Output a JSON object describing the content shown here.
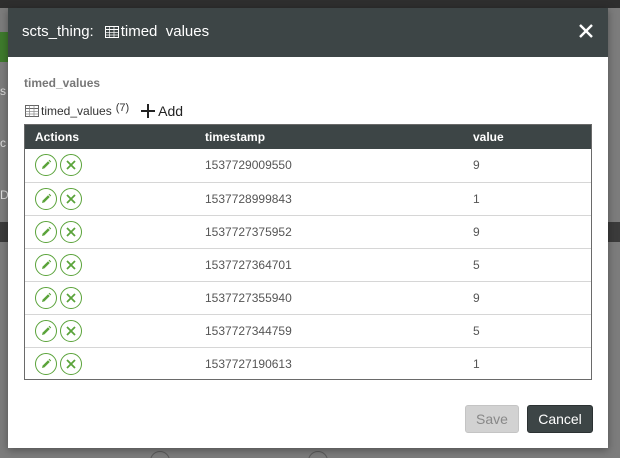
{
  "modal": {
    "thing_name": "scts_thing:",
    "entity_title": "timed  values",
    "section_title": "timed_values",
    "collection_label": "timed_values",
    "collection_count": "(7)",
    "add_label": "Add",
    "columns": [
      "Actions",
      "timestamp",
      "value"
    ],
    "rows": [
      {
        "timestamp": "1537729009550",
        "value": "9"
      },
      {
        "timestamp": "1537728999843",
        "value": "1"
      },
      {
        "timestamp": "1537727375952",
        "value": "9"
      },
      {
        "timestamp": "1537727364701",
        "value": "5"
      },
      {
        "timestamp": "1537727355940",
        "value": "9"
      },
      {
        "timestamp": "1537727344759",
        "value": "5"
      },
      {
        "timestamp": "1537727190613",
        "value": "1"
      }
    ],
    "save_label": "Save",
    "cancel_label": "Cancel"
  },
  "background": {
    "fragments": [
      "s",
      "c",
      "De"
    ]
  },
  "icons": {
    "close": "close-icon",
    "grid": "grid-icon",
    "edit": "pencil-icon",
    "delete": "x-circle-icon",
    "add": "plus-icon"
  },
  "colors": {
    "header": "#3d4546",
    "action_green": "#5aa33a"
  }
}
